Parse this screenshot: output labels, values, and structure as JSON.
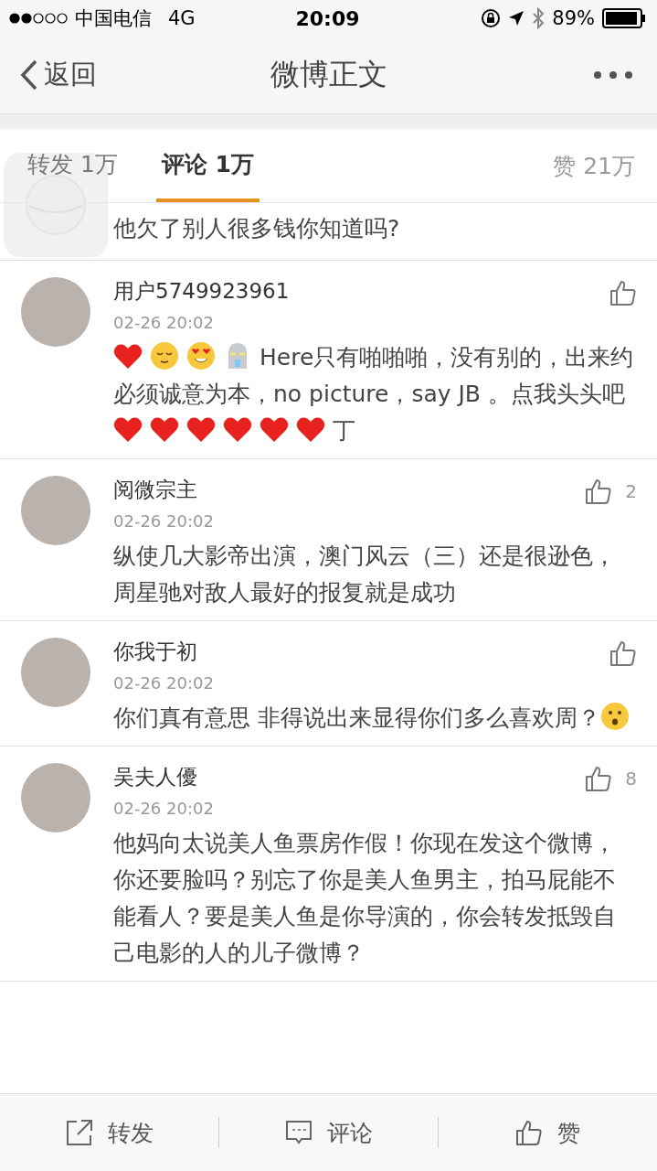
{
  "status_bar": {
    "signal_carrier": "中国电信",
    "network": "4G",
    "time": "20:09",
    "battery": "89%"
  },
  "nav": {
    "back": "返回",
    "title": "微博正文"
  },
  "tabs": [
    {
      "label": "转发 1万",
      "selected": false
    },
    {
      "label": "评论 1万",
      "selected": true
    }
  ],
  "likes_tab": "赞 21万",
  "partial_comment": "他欠了别人很多钱你知道吗?",
  "comments": [
    {
      "user": "用户5749923961",
      "time": "02-26 20:02",
      "segments": [
        {
          "kind": "heart"
        },
        {
          "kind": "relieved"
        },
        {
          "kind": "hearteyes"
        },
        {
          "kind": "robot"
        },
        {
          "kind": "text",
          "text": "Here只有啪啪啪，没有别的，出来约必须诚意为本，no picture，say JB 。点我头头吧"
        },
        {
          "kind": "heart"
        },
        {
          "kind": "heart"
        },
        {
          "kind": "heart"
        },
        {
          "kind": "heart"
        },
        {
          "kind": "heart"
        },
        {
          "kind": "heart"
        },
        {
          "kind": "text",
          "text": "丁"
        }
      ]
    },
    {
      "user": "阅微宗主",
      "time": "02-26 20:02",
      "like_count": "2",
      "segments": [
        {
          "kind": "text",
          "text": "纵使几大影帝出演，澳门风云（三）还是很逊色，周星驰对敌人最好的报复就是成功"
        }
      ]
    },
    {
      "user": "你我于初",
      "time": "02-26 20:02",
      "segments": [
        {
          "kind": "text",
          "text": "你们真有意思 非得说出来显得你们多么喜欢周？"
        },
        {
          "kind": "thinking"
        }
      ]
    },
    {
      "user": "吴夫人優",
      "time": "02-26 20:02",
      "like_count": "8",
      "segments": [
        {
          "kind": "text",
          "text": "他妈向太说美人鱼票房作假！你现在发这个微博，你还要脸吗？别忘了你是美人鱼男主，拍马屁能不能看人？要是美人鱼是你导演的，你会转发抵毁自己电影的人的儿子微博？"
        }
      ]
    }
  ],
  "toolbar": [
    {
      "kind": "repost",
      "label": "转发"
    },
    {
      "kind": "comment",
      "label": "评论"
    },
    {
      "kind": "like",
      "label": "赞"
    }
  ]
}
